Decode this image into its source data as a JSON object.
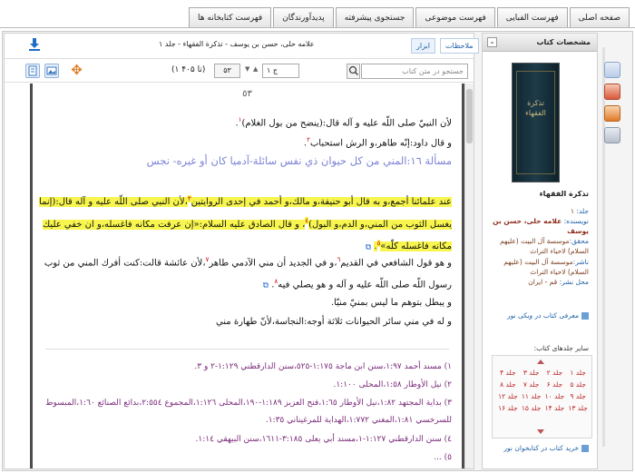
{
  "top_tabs": [
    {
      "label": "صفحه اصلی"
    },
    {
      "label": "فهرست الفبایی"
    },
    {
      "label": "فهرست موضوعی"
    },
    {
      "label": "جستجوی پیشرفته"
    },
    {
      "label": "پدیدآورندگان"
    },
    {
      "label": "فهرست کتابخانه ها"
    }
  ],
  "doc": {
    "breadcrumb": "علامه حلی، حسن بن یوسف - تذكرة الفقهاء - جلد ۱",
    "tab_bookmarks": "ملاحظات",
    "tab_tools": "ابزار",
    "page_info": "(۱ تا ۴۰۵)",
    "page_value": "۵۳",
    "volume_value": "ج ۱",
    "search_placeholder": "جستجو در متن کتاب"
  },
  "page": {
    "number": "٥٣",
    "p1": "لأن النبيّ صلى اللّه عليه و آله قال:(ينضح من بول الغلام)",
    "p1_note": "١",
    "p2": "و قال داود:إنّه طاهر،و الرش استحباب",
    "p2_note": "٢",
    "heading": "مسألة ١٦:المني من كل حيوان ذي نفس سائلة-آدميا كان أو غيره- نجس",
    "p3a": "عند علمائنا أجمع،و به قال أبو حنيفة،و مالك،و أحمد في إحدى الروايتين",
    "p3a_note": "٣",
    "p3b": "لأن النبي صلى اللّه عليه و آله قال:(إنما يغسل الثوب من المني،و الدم،و البول)",
    "p3b_note": "٤",
    "p3c": "و قال الصادق عليه السلام:«إن عرفت مكانه فاغسله،و ان خفي عليك مكانه فاغسله كلّه»",
    "p3c_note": "٥",
    "p4": "و هو قول الشافعي في القديم",
    "p4_note": "٦",
    "p4b": "و في الجديد أن مني الآدمي طاهر",
    "p4b_note": "٧",
    "p4c": "لأن عائشة قالت:كنت أفرك المني من ثوب رسول اللّه صلى اللّه عليه و آله و هو يصلي فيه",
    "p4c_note": "٨",
    "p5": "و يبطل بتوهم ما ليس بمنيّ منيّا.",
    "p6": "و له في مني سائر الحيوانات ثلاثة أوجه:النجاسة،لأنّ طهارة مني",
    "fn1": "١) مسند أحمد ١:٩٧،سنن ابن ماجة ١:١٧٥-٥٢٥،سنن الدارقطني ١:١٢٩-٢ و ٣.",
    "fn2": "٢) نيل الأوطار ١:٥٨،المحلى ١:١٠٠.",
    "fn3": "٣) بداية المجتهد ١:٨٢،نيل الأوطار ١:٦٥،فتح العزيز ١:١٨٩-١٩٠،المحلى ١:١٢٦،المجموع ٢:٥٥٤،بدائع الصنائع ١:٦٠،المبسوط للسرخسي ١:٨١،المغني ١:٧٧٢،الهداية للمرغيناني ١:٣٥.",
    "fn4": "٤) سنن الدارقطني ١:١٢٧-١،مسند أبي يعلى ٣:١٨٥-١٦١١،سنن البيهقي ١:١٤.",
    "fn5": "٥) ..."
  },
  "info": {
    "header": "مشخصات کتاب",
    "cover_title": "تذكرة الفقهاء",
    "book_title": "تذكرة الفقهاء",
    "volume_label": "جلد:",
    "volume_value": "۱",
    "author_label": "نویسنده:",
    "author_value": "علامه حلی، حسن بن یوسف",
    "researcher_label": "محقق:",
    "researcher_value": "موسسة آل البيت (عليهم السلام) لاحياء التراث",
    "publisher_label": "ناشر:",
    "publisher_value": "موسسة آل البيت (عليهم السلام) لاحياء التراث",
    "place_label": "محل نشر:",
    "place_value": "قم - ایران",
    "wiki_link": "معرفی کتاب در ویکی نور",
    "volumes_title": "سایر جلدهای کتاب:",
    "buy_link": "خرید کتاب در کتابخوان نور",
    "volumes": [
      "جلد ۱",
      "جلد ۲",
      "جلد ۳",
      "جلد ۴",
      "جلد ۵",
      "جلد ۶",
      "جلد ۷",
      "جلد ۸",
      "جلد ۹",
      "جلد ۱۰",
      "جلد ۱۱",
      "جلد ۱۲",
      "جلد ۱۳",
      "جلد ۱۴",
      "جلد ۱۵",
      "جلد ۱۶"
    ]
  },
  "colors": {
    "highlight": "#f8f64e",
    "heading": "#7c82d6",
    "footnote": "#7a2a7a",
    "link": "#1d5fa8",
    "volume": "#bb2222"
  },
  "icons": [
    "download-icon",
    "orange-crosshair-icon",
    "search-icon",
    "page-view-icon",
    "image-view-icon"
  ]
}
